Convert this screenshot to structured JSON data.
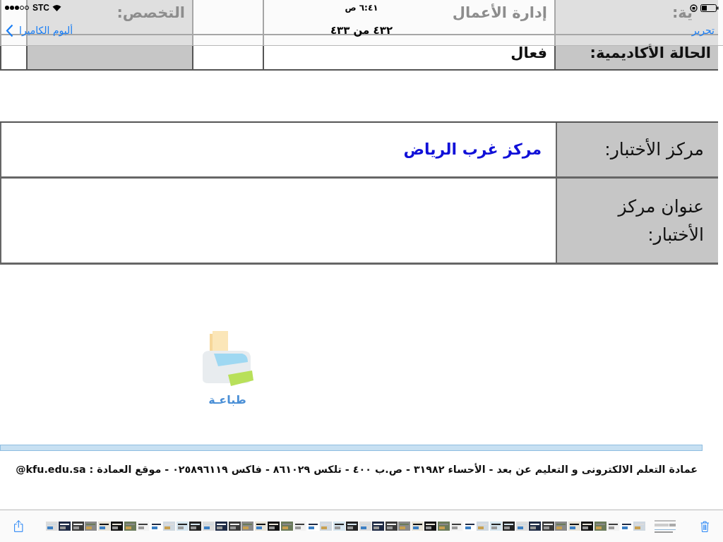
{
  "status_bar": {
    "carrier": "STC",
    "time": "٦:٤١ ص"
  },
  "nav": {
    "back": "ألبوم الكاميرا",
    "title": "٤٣٢ من ٤٣٣",
    "action": "تحرير"
  },
  "info_table": {
    "rows": [
      [
        {
          "kind": "label",
          "text": "ية:"
        },
        {
          "kind": "value",
          "text": "إدارة الأعمال"
        },
        {
          "kind": "value"
        },
        {
          "kind": "label",
          "text": "التخصص:"
        },
        {
          "kind": "value"
        }
      ],
      [
        {
          "kind": "label",
          "text": "الحالة الأكاديمية:"
        },
        {
          "kind": "value",
          "text": "فعال"
        },
        {
          "kind": "value"
        },
        {
          "kind": "label"
        },
        {
          "kind": "value"
        }
      ]
    ]
  },
  "exam_table": {
    "rows": [
      {
        "label": "مركز الأختبار:",
        "value": "مركز غرب الرياض"
      },
      {
        "label": "عنوان مركز الأختبار:"
      }
    ]
  },
  "print": {
    "label": "طباعـة"
  },
  "footer": "@kfu.edu.sa : عمادة التعلم الالكترونى و التعليم عن بعد - الأحساء ٣١٩٨٢ - ص.ب ٤٠٠ - تلكس ٨٦١٠٢٩ - فاكس ٠٢٥٨٩٦١١٩ - موقع العمادة"
}
